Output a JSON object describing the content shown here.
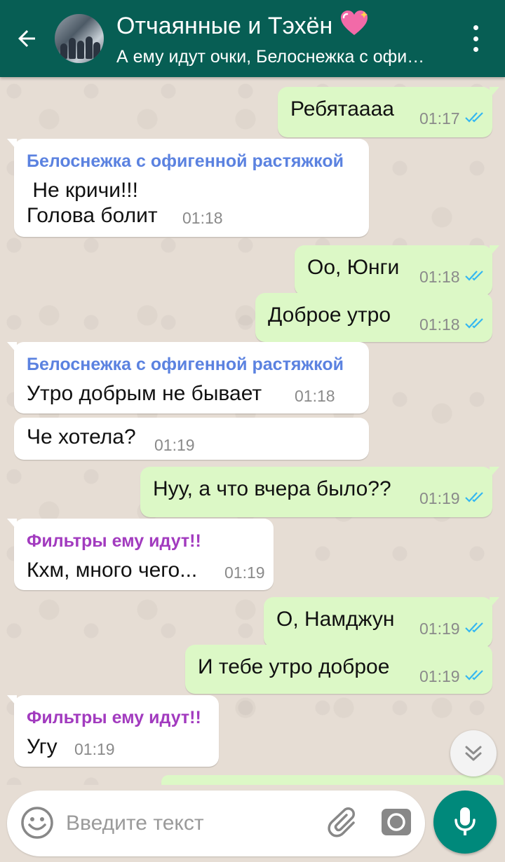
{
  "header": {
    "title": "Отчаянные и Тэхён",
    "heart_emoji": "💖",
    "subtitle": "А ему идут очки, Белоснежка с офи…",
    "back_icon": "arrow-back-icon",
    "menu_icon": "more-vert-icon"
  },
  "colors": {
    "header_bg": "#075e54",
    "outgoing_bubble": "#dcf8c6",
    "incoming_bubble": "#ffffff",
    "sender_blue": "#5b82e0",
    "sender_purple": "#a23bbf",
    "read_ticks": "#34b7f1",
    "mic_button": "#00897b"
  },
  "messages": [
    {
      "dir": "out",
      "text": "Ребятаааа",
      "time": "01:17",
      "read": true
    },
    {
      "dir": "in",
      "sender": "Белоснежка с офигенной растяжкой",
      "sender_color": "#5b82e0",
      "text": " Не кричи!!!\nГолова болит",
      "time": "01:18"
    },
    {
      "dir": "out",
      "text": "Оо, Юнги",
      "time": "01:18",
      "read": true
    },
    {
      "dir": "out",
      "text": "Доброе утро",
      "time": "01:18",
      "read": true
    },
    {
      "dir": "in",
      "sender": "Белоснежка с офигенной растяжкой",
      "sender_color": "#5b82e0",
      "text": "Утро добрым не бывает",
      "time": "01:18"
    },
    {
      "dir": "in",
      "text": "Че хотела?",
      "time": "01:19"
    },
    {
      "dir": "out",
      "text": "Нуу, а что вчера было??",
      "time": "01:19",
      "read": true
    },
    {
      "dir": "in",
      "sender": "Фильтры ему идут!!",
      "sender_color": "#a23bbf",
      "text": "Кхм, много чего...",
      "time": "01:19"
    },
    {
      "dir": "out",
      "text": "О, Намджун",
      "time": "01:19",
      "read": true
    },
    {
      "dir": "out",
      "text": "И тебе утро доброе",
      "time": "01:19",
      "read": true
    },
    {
      "dir": "in",
      "sender": "Фильтры ему идут!!",
      "sender_color": "#a23bbf",
      "text": "Угу",
      "time": "01:19"
    }
  ],
  "composer": {
    "placeholder": "Введите текст",
    "emoji_icon": "emoji-icon",
    "attach_icon": "paperclip-icon",
    "camera_icon": "camera-icon",
    "mic_icon": "mic-icon"
  },
  "scroll_down_icon": "chevron-double-down-icon"
}
